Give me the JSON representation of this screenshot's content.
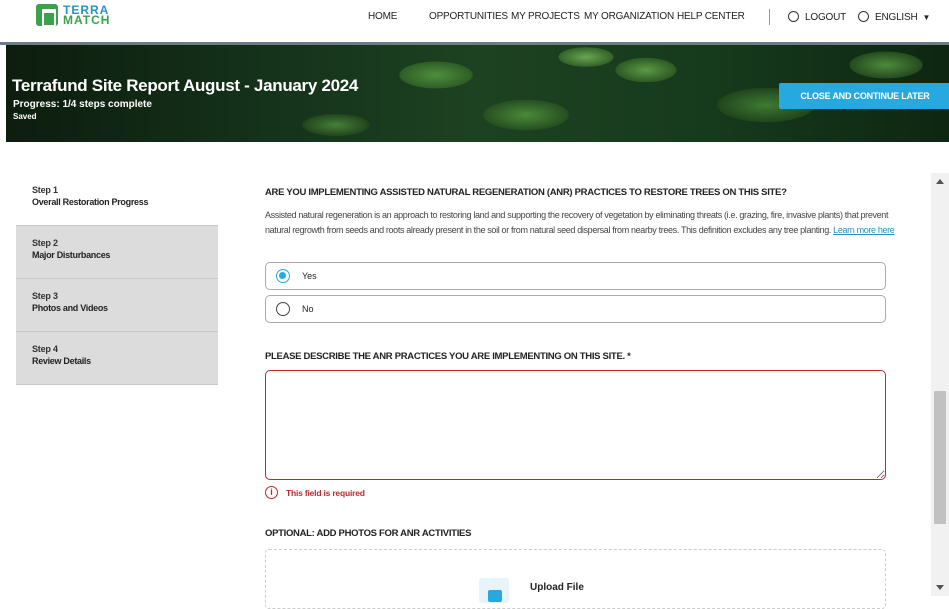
{
  "brand": {
    "line1": "TERRA",
    "line2": "MATCH"
  },
  "nav": {
    "home": "HOME",
    "opportunities": "OPPORTUNITIES",
    "my_projects": "MY PROJECTS",
    "my_organization": "MY ORGANIZATION",
    "help_center": "HELP CENTER",
    "logout": "LOGOUT",
    "language": "ENGLISH"
  },
  "header": {
    "title": "Terrafund Site Report August - January 2024",
    "progress": "Progress: 1/4 steps complete",
    "status": "Saved",
    "close_button": "CLOSE AND CONTINUE LATER"
  },
  "steps": [
    {
      "step": "Step 1",
      "title": "Overall Restoration Progress"
    },
    {
      "step": "Step 2",
      "title": "Major Disturbances"
    },
    {
      "step": "Step 3",
      "title": "Photos and Videos"
    },
    {
      "step": "Step 4",
      "title": "Review Details"
    }
  ],
  "form": {
    "q1": "ARE YOU IMPLEMENTING ASSISTED NATURAL REGENERATION (ANR) PRACTICES TO RESTORE TREES ON THIS SITE?",
    "q1_description": "Assisted natural regeneration is an approach to restoring land and supporting the recovery of vegetation by eliminating threats (i.e. grazing, fire, invasive plants) that prevent natural regrowth from seeds and roots already present in the soil or from natural seed dispersal from nearby trees. This definition excludes any tree planting.",
    "q1_link": "Learn more here",
    "options": [
      {
        "label": "Yes",
        "selected": true
      },
      {
        "label": "No",
        "selected": false
      }
    ],
    "q2": "PLEASE DESCRIBE THE ANR PRACTICES YOU ARE IMPLEMENTING ON THIS SITE. *",
    "q2_value": "",
    "error": "This field is required",
    "q3": "OPTIONAL: ADD PHOTOS FOR ANR ACTIVITIES",
    "upload_label": "Upload File"
  },
  "colors": {
    "accent": "#27a9e0",
    "error": "#c0262b",
    "brand_green": "#3aa24a"
  }
}
